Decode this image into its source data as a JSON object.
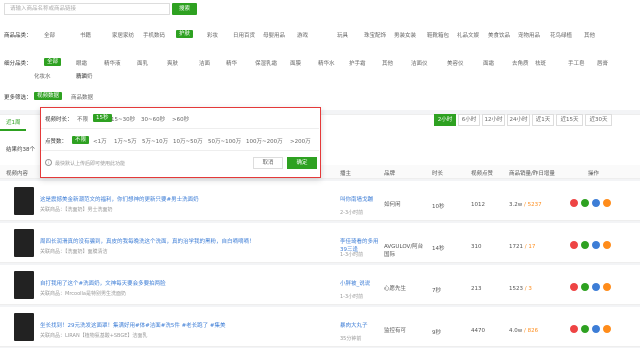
{
  "search": {
    "placeholder": "请输入商品名称或商品链接",
    "button": "搜索"
  },
  "filters": {
    "category_label": "商品品类：",
    "categories": [
      "全部",
      "书籍",
      "家居家纺",
      "手机数码",
      "护肤",
      "彩妆",
      "日用百货",
      "母婴用品",
      "游戏",
      "玩具",
      "珠宝配饰",
      "男装女装",
      "鞋靴箱包",
      "礼品文娱",
      "美食饮品",
      "宠物用品",
      "花鸟绿植",
      "其他"
    ],
    "sub_label": "细分品类：",
    "subcategories": [
      "全部",
      "眼霜",
      "精华液",
      "面乳",
      "爽肤",
      "洁面",
      "精华",
      "保湿乳霜",
      "面膜",
      "精华水",
      "护手霜",
      "其他",
      "洁面仪",
      "美容仪",
      "面霜",
      "去角质",
      "祛斑",
      "手工皂",
      "唇膏",
      "化妆水",
      "精油",
      "洗面奶"
    ],
    "more_label": "更多筛选：",
    "more_options": [
      "视频数据",
      "商品数据"
    ]
  },
  "popup": {
    "duration_label": "视频时长：",
    "durations": [
      "不限",
      "15秒",
      "15~30秒",
      "30~60秒",
      ">60秒"
    ],
    "likes_label": "点赞数：",
    "likes": [
      "不限",
      "<1万",
      "1万~5万",
      "5万~10万",
      "10万~50万",
      "50万~100万",
      "100万~200万",
      ">200万"
    ],
    "note": "最快默认上传后即可使用此功能",
    "cancel": "取消",
    "confirm": "确定"
  },
  "tab": {
    "label": "近1周"
  },
  "time_tabs": [
    "2小时",
    "6小时",
    "12小时",
    "24小时",
    "近1天",
    "近15天",
    "近30天"
  ],
  "result_text": "结果约38个",
  "table": {
    "headers": [
      "视频内容",
      "播主",
      "品牌",
      "时长",
      "视频点赞",
      "商品销量/昨日增量",
      "操作"
    ],
    "rows": [
      {
        "title": "这是震撼美金新潮范文的福利，你们想神的更新只要#男士洗面奶",
        "goods": "关联商品：【洗面奶】男士洗面奶",
        "author": "叫你南墙戈蹦",
        "author_time": "2-3小时前",
        "brand": "如何闲",
        "duration": "10秒",
        "likes": "1012",
        "sales": "3.2w",
        "delta": "5237"
      },
      {
        "title": "周四长润滑真的没有骗到，真皮的我每晚洗这个洗面，真的治学我的黑粉，自白嘀嘀嘀！",
        "goods": "关联商品：【洗面奶】面膜清洁",
        "author": "李佳琦看的多用39三逢",
        "author_time": "1-3小时前",
        "brand": "AVGULOV/阿台国际",
        "duration": "14秒",
        "likes": "310",
        "sales": "1721",
        "delta": "17"
      },
      {
        "title": "自打我用了这个#洗面奶，文神每天要会多要拍两脸",
        "goods": "关联商品：Mrcoolla是特别男生洗面奶",
        "author": "小胖被_说说",
        "author_time": "1-3小时前",
        "brand": "心愿先生",
        "duration": "7秒",
        "likes": "213",
        "sales": "1523",
        "delta": "3"
      },
      {
        "title": "坐长找到！29元洗发这面罩！集满好用#体#洁面#洗5件 #老长跑了 #集美",
        "goods": "关联商品：LIRAN【植物氨基酸+SBGE】洁面乳",
        "author": "暴肉大丸子",
        "author_time": "35分钟前",
        "brand": "监控有可",
        "duration": "9秒",
        "likes": "4470",
        "sales": "4.0w",
        "delta": "826"
      }
    ]
  },
  "colors": {
    "accent": "#2ea121",
    "link": "#3d7dd6",
    "highlight": "#e43a3a"
  }
}
